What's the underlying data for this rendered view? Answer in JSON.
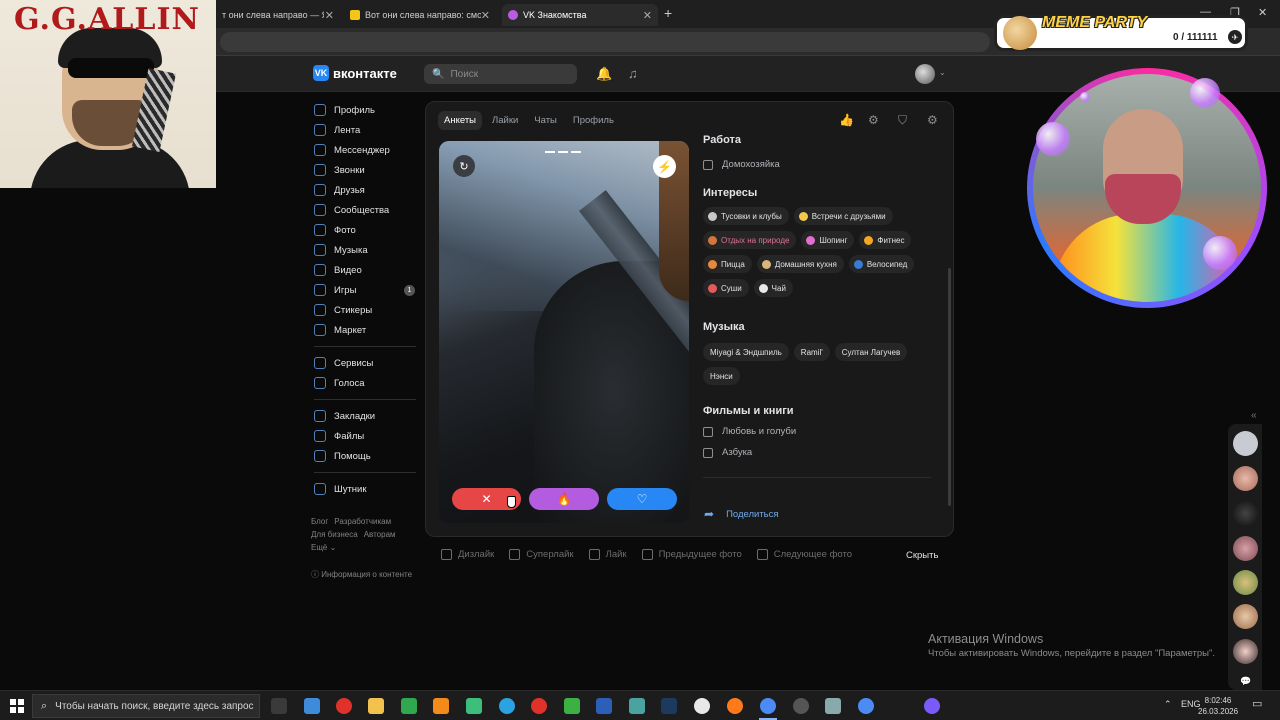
{
  "browser": {
    "tabs": [
      {
        "title": "т они слева направо — Янд",
        "active": false
      },
      {
        "title": "Вот они слева направо: смотр",
        "active": false
      },
      {
        "title": "VK Знакомства",
        "active": true
      }
    ],
    "new_tab": "+",
    "win_min": "—",
    "win_max": "❐",
    "win_close": "✕"
  },
  "vk": {
    "logo_mark": "VK",
    "logo_text": "вконтакте",
    "search_placeholder": "Поиск",
    "search_icon": "🔍",
    "bell_icon": "🔔",
    "music_icon": "♫",
    "avatar_chevron": "⌄"
  },
  "nav": {
    "group1": [
      {
        "label": "Профиль",
        "icon": "user-icon"
      },
      {
        "label": "Лента",
        "icon": "feed-icon"
      },
      {
        "label": "Мессенджер",
        "icon": "messenger-icon"
      },
      {
        "label": "Звонки",
        "icon": "phone-icon"
      },
      {
        "label": "Друзья",
        "icon": "friends-icon"
      },
      {
        "label": "Сообщества",
        "icon": "communities-icon"
      },
      {
        "label": "Фото",
        "icon": "photo-icon"
      },
      {
        "label": "Музыка",
        "icon": "music-icon"
      },
      {
        "label": "Видео",
        "icon": "video-icon"
      },
      {
        "label": "Игры",
        "icon": "games-icon",
        "badge": "1"
      },
      {
        "label": "Стикеры",
        "icon": "stickers-icon"
      },
      {
        "label": "Маркет",
        "icon": "market-icon"
      }
    ],
    "group2": [
      {
        "label": "Сервисы",
        "icon": "services-icon"
      },
      {
        "label": "Голоса",
        "icon": "votes-icon"
      }
    ],
    "group3": [
      {
        "label": "Закладки",
        "icon": "bookmarks-icon"
      },
      {
        "label": "Файлы",
        "icon": "files-icon"
      },
      {
        "label": "Помощь",
        "icon": "help-icon"
      }
    ],
    "group4": [
      {
        "label": "Шутник",
        "icon": "joker-icon"
      }
    ],
    "footer": {
      "blog": "Блог",
      "developers": "Разработчикам",
      "business": "Для бизнеса",
      "authors": "Авторам",
      "more": "Ещё ⌄"
    },
    "info": "ⓘ Информация о контенте"
  },
  "panel": {
    "tabs": [
      "Анкеты",
      "Лайки",
      "Чаты",
      "Профиль"
    ],
    "active_tab": "Анкеты",
    "icons": [
      "like-icon",
      "filters-icon",
      "shield-icon",
      "settings-icon"
    ],
    "icon_glyphs": {
      "like": "👍",
      "filters": "⚙",
      "shield": "⛉",
      "settings": "⚙"
    },
    "undo_glyph": "↻",
    "bolt_glyph": "⚡",
    "dislike_glyph": "✕",
    "superlike_glyph": "🔥",
    "like_glyph": "♡",
    "work_title": "Работа",
    "work_value": "Домохозяйка",
    "interests_title": "Интересы",
    "interests": [
      {
        "label": "Тусовки и клубы",
        "color": "#c9c9c9",
        "highlight": false
      },
      {
        "label": "Встречи с друзьями",
        "color": "#f2c94c",
        "highlight": false
      },
      {
        "label": "Отдых на природе",
        "color": "#d4763b",
        "highlight": true
      },
      {
        "label": "Шопинг",
        "color": "#e06fd0",
        "highlight": false
      },
      {
        "label": "Фитнес",
        "color": "#f5a623",
        "highlight": false
      },
      {
        "label": "Пицца",
        "color": "#e8893a",
        "highlight": false
      },
      {
        "label": "Домашняя кухня",
        "color": "#d9b77a",
        "highlight": false
      },
      {
        "label": "Велосипед",
        "color": "#3a7bd5",
        "highlight": false
      },
      {
        "label": "Суши",
        "color": "#e55b5b",
        "highlight": false
      },
      {
        "label": "Чай",
        "color": "#e9e9e9",
        "highlight": false
      }
    ],
    "music_title": "Музыка",
    "music": [
      "Miyagi & Эндшпиль",
      "Ramil'",
      "Султан Лагучев",
      "Нэнси"
    ],
    "films_title": "Фильмы и книги",
    "films": [
      "Любовь и голуби",
      "Азбука"
    ],
    "share_label": "Поделиться",
    "share_glyph": "➦"
  },
  "hints": [
    {
      "label": "Дизлайк"
    },
    {
      "label": "Суперлайк"
    },
    {
      "label": "Лайк"
    },
    {
      "label": "Предыдущее фото"
    },
    {
      "label": "Следующее фото"
    }
  ],
  "hide_label": "Скрыть",
  "side": {
    "collapse": "«",
    "chat": "💬"
  },
  "overlay": {
    "ggallin_title": "G.G.ALLIN",
    "meme_title": "MEME PARTY",
    "meme_counter": "0 / 111111",
    "meme_paw": "✈"
  },
  "windows": {
    "activation_title": "Активация Windows",
    "activation_text": "Чтобы активировать Windows, перейдите в раздел \"Параметры\".",
    "search_placeholder": "Чтобы начать поиск, введите здесь запрос",
    "search_icon": "⌕",
    "tray_up": "⌃",
    "lang": "ENG",
    "time": "8:02:46",
    "date": "26.03.2026",
    "notif": "▭"
  }
}
